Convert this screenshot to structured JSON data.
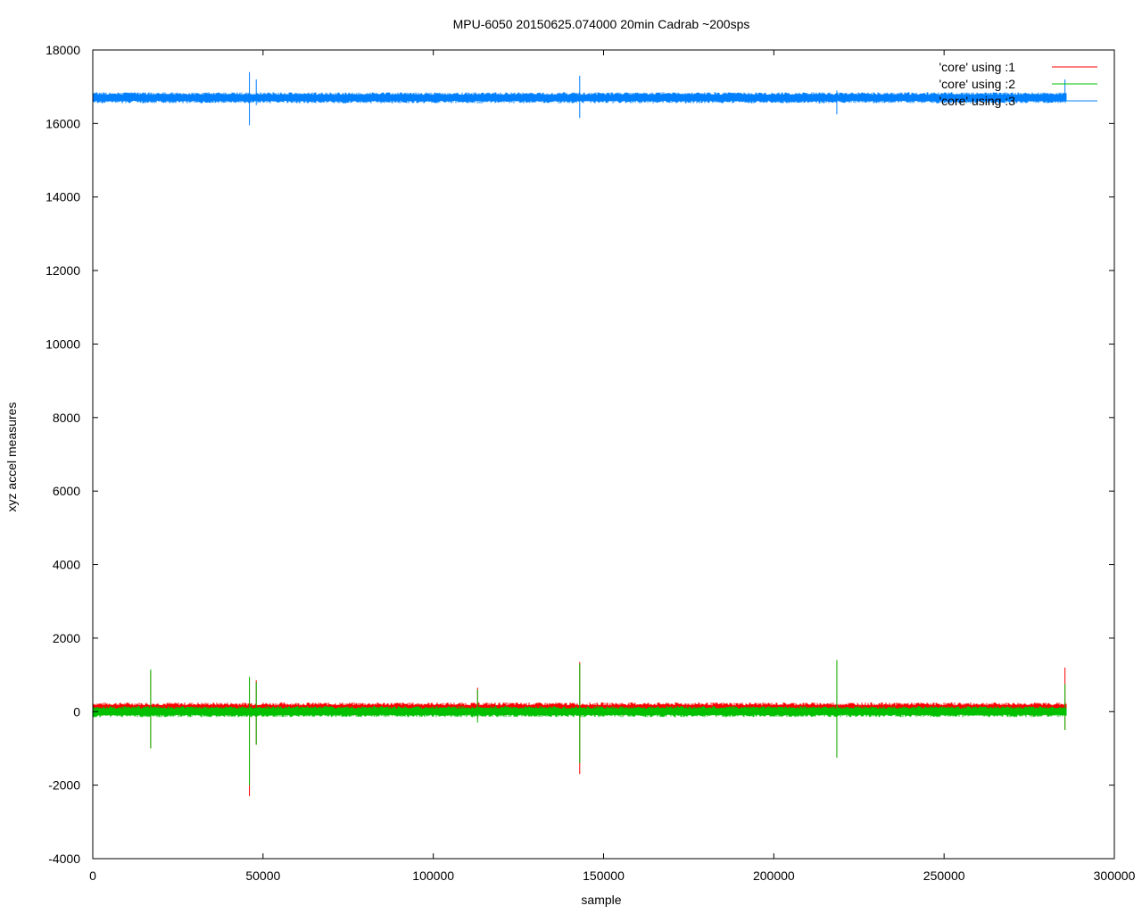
{
  "chart_data": {
    "type": "line",
    "title": "MPU-6050 20150625.074000 20min Cadrab ~200sps",
    "xlabel": "sample",
    "ylabel": "xyz accel measures",
    "xlim": [
      0,
      300000
    ],
    "ylim": [
      -4000,
      18000
    ],
    "x_ticks": [
      "0",
      "50000",
      "100000",
      "150000",
      "200000",
      "250000",
      "300000"
    ],
    "y_ticks": [
      "-4000",
      "-2000",
      "0",
      "2000",
      "4000",
      "6000",
      "8000",
      "10000",
      "12000",
      "14000",
      "16000",
      "18000"
    ],
    "grid": false,
    "legend": "top-right",
    "x_end": 286000,
    "series": [
      {
        "name": "'core' using :1",
        "color": "#ff0000",
        "band": [
          -100,
          250
        ],
        "spikes": [
          [
            17000,
            1100,
            -1000
          ],
          [
            46000,
            900,
            -2300
          ],
          [
            48000,
            850,
            -900
          ],
          [
            113000,
            650,
            -200
          ],
          [
            143000,
            1350,
            -1700
          ],
          [
            218500,
            1400,
            -1250
          ],
          [
            285500,
            1200,
            -500
          ]
        ]
      },
      {
        "name": "'core' using :2",
        "color": "#00c000",
        "band": [
          -150,
          150
        ],
        "spikes": [
          [
            17000,
            1150,
            -1000
          ],
          [
            46000,
            950,
            -2000
          ],
          [
            48000,
            800,
            -900
          ],
          [
            113000,
            600,
            -300
          ],
          [
            143000,
            1300,
            -1400
          ],
          [
            218500,
            1400,
            -1250
          ],
          [
            285500,
            750,
            -500
          ]
        ]
      },
      {
        "name": "'core' using :3",
        "color": "#0080ff",
        "band": [
          16550,
          16850
        ],
        "spikes": [
          [
            46000,
            17400,
            15950
          ],
          [
            48000,
            17200,
            16500
          ],
          [
            143000,
            17300,
            16150
          ],
          [
            218500,
            16900,
            16250
          ],
          [
            285500,
            17200,
            16600
          ]
        ]
      }
    ]
  }
}
